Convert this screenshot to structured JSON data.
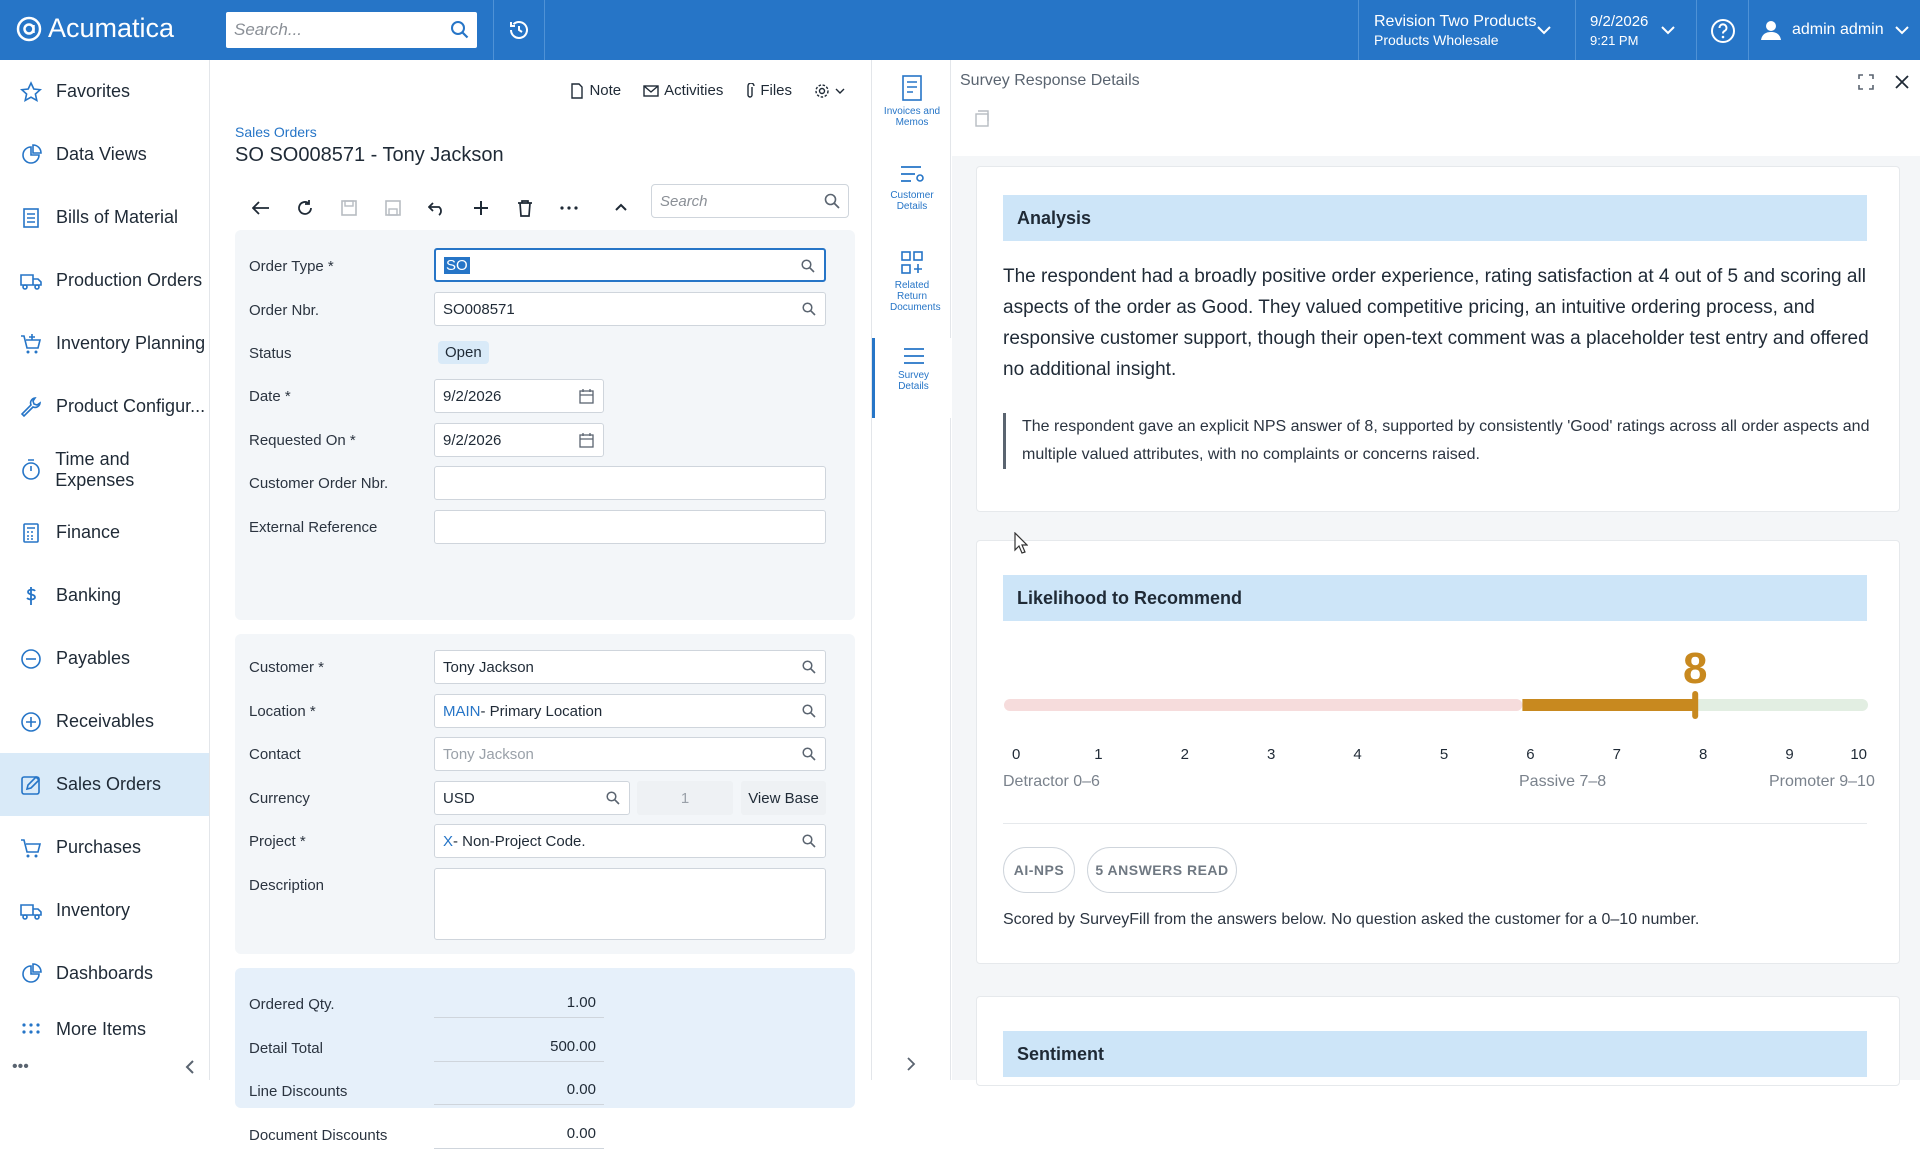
{
  "topbar": {
    "logo": "Acumatica",
    "search_placeholder": "Search...",
    "company": "Revision Two Products",
    "branch": "Products Wholesale",
    "date": "9/2/2026",
    "time": "9:21 PM",
    "user": "admin admin"
  },
  "sidebar": {
    "items": [
      {
        "label": "Favorites",
        "icon": "star-icon"
      },
      {
        "label": "Data Views",
        "icon": "pie-chart-icon"
      },
      {
        "label": "Bills of Material",
        "icon": "document-list-icon"
      },
      {
        "label": "Production Orders",
        "icon": "truck-icon"
      },
      {
        "label": "Inventory Planning",
        "icon": "cart-plus-icon"
      },
      {
        "label": "Product Configur...",
        "icon": "wrench-icon"
      },
      {
        "label": "Time and Expenses",
        "icon": "stopwatch-icon"
      },
      {
        "label": "Finance",
        "icon": "calculator-icon"
      },
      {
        "label": "Banking",
        "icon": "dollar-icon"
      },
      {
        "label": "Payables",
        "icon": "minus-circle-icon"
      },
      {
        "label": "Receivables",
        "icon": "plus-circle-icon"
      },
      {
        "label": "Sales Orders",
        "icon": "edit-icon"
      },
      {
        "label": "Purchases",
        "icon": "cart-icon"
      },
      {
        "label": "Inventory",
        "icon": "truck-icon"
      },
      {
        "label": "Dashboards",
        "icon": "dashboard-icon"
      },
      {
        "label": "More Items",
        "icon": "grid-icon"
      }
    ],
    "active_index": 11
  },
  "form": {
    "links": {
      "note": "Note",
      "activities": "Activities",
      "files": "Files"
    },
    "breadcrumb": "Sales Orders",
    "title": "SO SO008571 - Tony Jackson",
    "search_placeholder": "Search",
    "fields": {
      "order_type_label": "Order Type *",
      "order_type": "SO",
      "order_nbr_label": "Order Nbr.",
      "order_nbr": "SO008571",
      "status_label": "Status",
      "status": "Open",
      "date_label": "Date *",
      "date": "9/2/2026",
      "requested_label": "Requested On *",
      "requested": "9/2/2026",
      "cust_order_label": "Customer Order Nbr.",
      "cust_order": "",
      "ext_ref_label": "External Reference",
      "ext_ref": "",
      "customer_label": "Customer *",
      "customer": "Tony Jackson",
      "location_label": "Location *",
      "location_code": "MAIN",
      "location_name": " - Primary Location",
      "contact_label": "Contact",
      "contact": "Tony Jackson",
      "currency_label": "Currency",
      "currency": "USD",
      "rate": "1",
      "view_base": "View Base",
      "project_label": "Project *",
      "project_code": "X",
      "project_name": " - Non-Project Code.",
      "description_label": "Description"
    },
    "totals": [
      {
        "label": "Ordered Qty.",
        "value": "1.00"
      },
      {
        "label": "Detail Total",
        "value": "500.00"
      },
      {
        "label": "Line Discounts",
        "value": "0.00"
      },
      {
        "label": "Document Discounts",
        "value": "0.00"
      }
    ]
  },
  "right_panel": {
    "items": [
      {
        "label": "Invoices and Memos",
        "icon": "invoice-icon"
      },
      {
        "label": "Customer Details",
        "icon": "list-icon"
      },
      {
        "label": "Related Return Documents",
        "icon": "return-docs-icon"
      },
      {
        "label": "Survey Details",
        "icon": "menu-icon"
      }
    ]
  },
  "survey": {
    "title": "Survey Response Details",
    "analysis": {
      "heading": "Analysis",
      "text": "The respondent had a broadly positive order experience, rating satisfaction at 4 out of 5 and scoring all aspects of the order as Good. They valued competitive pricing, an intuitive ordering process, and responsive customer support, though their open-text comment was a placeholder test entry and offered no additional insight.",
      "quote": "The respondent gave an explicit NPS answer of 8, supported by consistently 'Good' ratings across all order aspects and multiple valued attributes, with no complaints or concerns raised."
    },
    "nps": {
      "heading": "Likelihood to Recommend",
      "score": 8,
      "score_label": "8",
      "scale_min": 0,
      "scale_max": 10,
      "ticks": [
        "0",
        "1",
        "2",
        "3",
        "4",
        "5",
        "6",
        "7",
        "8",
        "9",
        "10"
      ],
      "detractor": "Detractor 0–6",
      "passive": "Passive 7–8",
      "promoter": "Promoter 9–10",
      "pill_ai": "AI-NPS",
      "pill_answers": "5 ANSWERS READ",
      "note": "Scored by SurveyFill from the answers below. No question asked the customer for a 0–10 number.",
      "colors": {
        "detractor": "#f6dcdc",
        "passive": "#c8891f",
        "promoter": "#e2eee2"
      }
    },
    "sentiment": {
      "heading": "Sentiment"
    }
  }
}
